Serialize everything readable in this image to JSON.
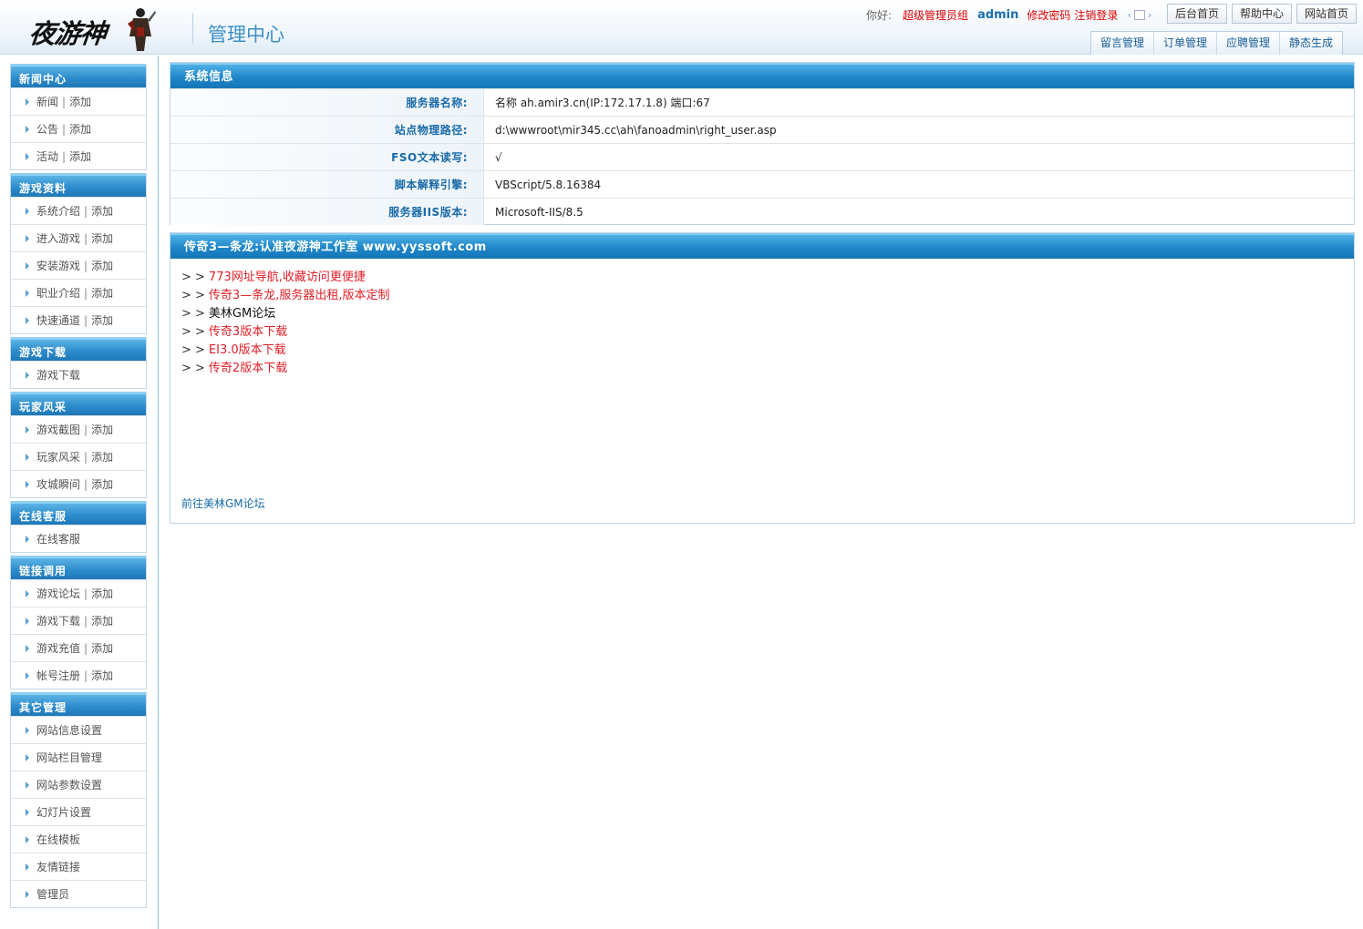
{
  "header": {
    "logo_text": "夜游神",
    "title": "管理中心",
    "greeting": "你好:",
    "user_group": "超级管理员组",
    "username": "admin",
    "change_password": "修改密码",
    "logout": "注销登录",
    "buttons": {
      "admin_home": "后台首页",
      "help_center": "帮助中心",
      "site_home": "网站首页"
    },
    "subnav": [
      "留言管理",
      "订单管理",
      "应聘管理",
      "静态生成"
    ]
  },
  "sidebar": {
    "groups": [
      {
        "title": "新闻中心",
        "items": [
          {
            "label": "新闻",
            "add": "添加"
          },
          {
            "label": "公告",
            "add": "添加"
          },
          {
            "label": "活动",
            "add": "添加"
          }
        ]
      },
      {
        "title": "游戏资料",
        "items": [
          {
            "label": "系统介绍",
            "add": "添加"
          },
          {
            "label": "进入游戏",
            "add": "添加"
          },
          {
            "label": "安装游戏",
            "add": "添加"
          },
          {
            "label": "职业介绍",
            "add": "添加"
          },
          {
            "label": "快速通道",
            "add": "添加"
          }
        ]
      },
      {
        "title": "游戏下载",
        "items": [
          {
            "label": "游戏下载"
          }
        ]
      },
      {
        "title": "玩家风采",
        "items": [
          {
            "label": "游戏截图",
            "add": "添加"
          },
          {
            "label": "玩家风采",
            "add": "添加"
          },
          {
            "label": "攻城瞬间",
            "add": "添加"
          }
        ]
      },
      {
        "title": "在线客服",
        "items": [
          {
            "label": "在线客服"
          }
        ]
      },
      {
        "title": "链接调用",
        "items": [
          {
            "label": "游戏论坛",
            "add": "添加"
          },
          {
            "label": "游戏下载",
            "add": "添加"
          },
          {
            "label": "游戏充值",
            "add": "添加"
          },
          {
            "label": "帐号注册",
            "add": "添加"
          }
        ]
      },
      {
        "title": "其它管理",
        "items": [
          {
            "label": "网站信息设置"
          },
          {
            "label": "网站栏目管理"
          },
          {
            "label": "网站参数设置"
          },
          {
            "label": "幻灯片设置"
          },
          {
            "label": "在线模板"
          },
          {
            "label": "友情链接"
          },
          {
            "label": "管理员"
          }
        ]
      }
    ]
  },
  "system_info": {
    "title": "系统信息",
    "rows": [
      {
        "label": "服务器名称:",
        "value": "名称 ah.amir3.cn(IP:172.17.1.8) 端口:67"
      },
      {
        "label": "站点物理路径:",
        "value": "d:\\wwwroot\\mir345.cc\\ah\\fanoadmin\\right_user.asp"
      },
      {
        "label": "FSO文本读写:",
        "value": "√"
      },
      {
        "label": "脚本解释引擎:",
        "value": "VBScript/5.8.16384"
      },
      {
        "label": "服务器IIS版本:",
        "value": "Microsoft-IIS/8.5"
      }
    ]
  },
  "promo": {
    "title": "传奇3—条龙:认准夜游神工作室 www.yyssoft.com",
    "prefix": "> >",
    "links": [
      {
        "text": "773网址导航,收藏访问更便捷",
        "style": "red"
      },
      {
        "text": "传奇3—条龙,服务器出租,版本定制",
        "style": "red"
      },
      {
        "text": "美林GM论坛",
        "style": "dark"
      },
      {
        "text": "传奇3版本下载",
        "style": "red"
      },
      {
        "text": "EI3.0版本下载",
        "style": "red"
      },
      {
        "text": "传奇2版本下载",
        "style": "red"
      }
    ],
    "forum_link": "前往美林GM论坛"
  },
  "colors": {
    "accent": "#1e86c8",
    "link_red": "#e0202a",
    "label_blue": "#1a6ba8"
  }
}
